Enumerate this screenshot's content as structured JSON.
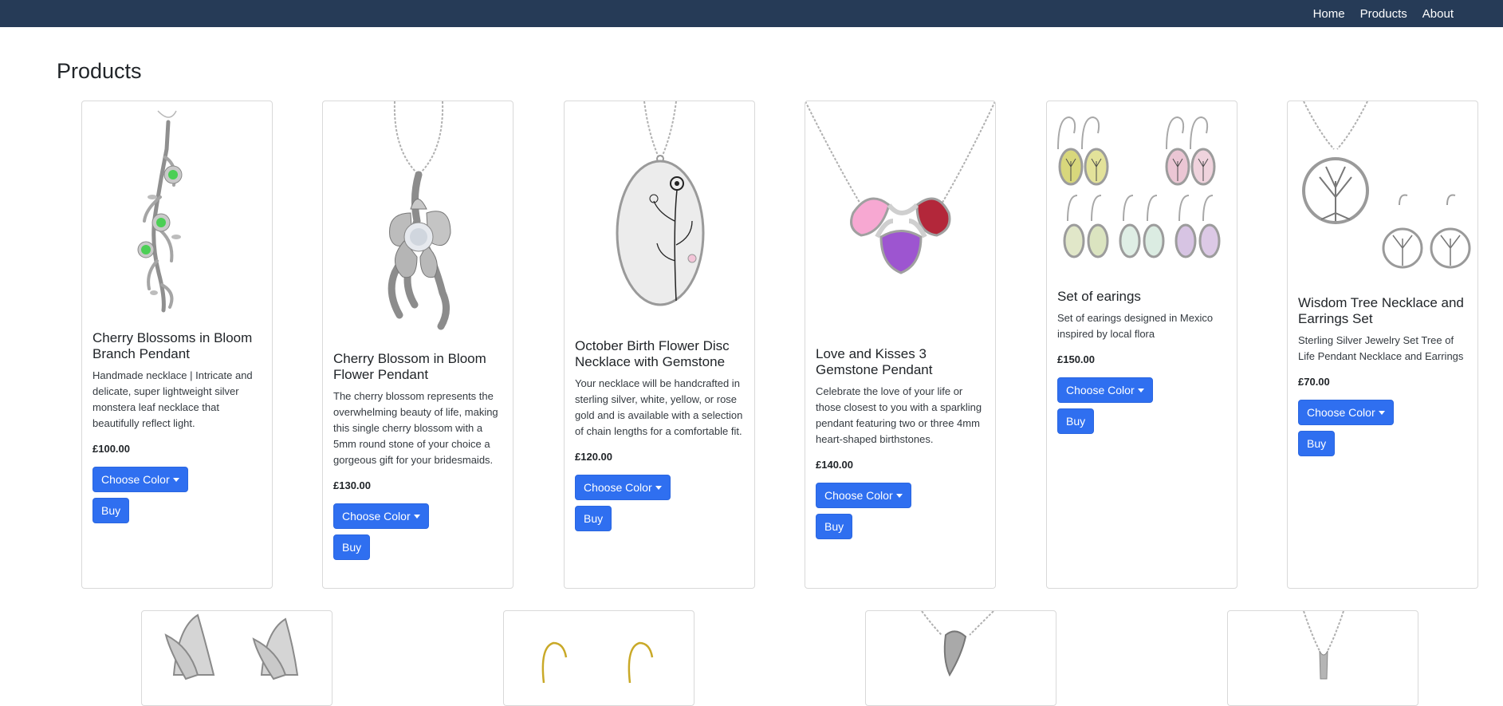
{
  "nav": {
    "links": [
      "Home",
      "Products",
      "About"
    ]
  },
  "page": {
    "title": "Products"
  },
  "products": [
    {
      "title": "Cherry Blossoms in Bloom Branch Pendant",
      "description": "Handmade necklace | Intricate and delicate, super lightweight silver monstera leaf necklace that beautifully reflect light.",
      "price": "£100.00",
      "color_button": "Choose Color",
      "buy_button": "Buy",
      "image": "cherry-blossom-branch-pendant-image"
    },
    {
      "title": "Cherry Blossom in Bloom Flower Pendant",
      "description": "The cherry blossom represents the overwhelming beauty of life, making this single cherry blossom with a 5mm round stone of your choice a gorgeous gift for your bridesmaids.",
      "price": "£130.00",
      "color_button": "Choose Color",
      "buy_button": "Buy",
      "image": "cherry-blossom-flower-pendant-image"
    },
    {
      "title": "October Birth Flower Disc Necklace with Gemstone",
      "description": "Your necklace will be handcrafted in sterling silver, white, yellow, or rose gold and is available with a selection of chain lengths for a comfortable fit.",
      "price": "£120.00",
      "color_button": "Choose Color",
      "buy_button": "Buy",
      "image": "birth-flower-disc-necklace-image"
    },
    {
      "title": "Love and Kisses 3 Gemstone Pendant",
      "description": "Celebrate the love of your life or those closest to you with a sparkling pendant featuring two or three 4mm heart-shaped birthstones.",
      "price": "£140.00",
      "color_button": "Choose Color",
      "buy_button": "Buy",
      "image": "three-heart-gemstone-pendant-image"
    },
    {
      "title": "Set of earings",
      "description": "Set of earings designed in Mexico inspired by local flora",
      "price": "£150.00",
      "color_button": "Choose Color",
      "buy_button": "Buy",
      "image": "tree-earrings-set-image"
    },
    {
      "title": "Wisdom Tree Necklace and Earrings Set",
      "description": "Sterling Silver Jewelry Set Tree of Life Pendant Necklace and Earrings",
      "price": "£70.00",
      "color_button": "Choose Color",
      "buy_button": "Buy",
      "image": "tree-of-life-set-image"
    }
  ],
  "second_row": [
    {
      "image": "leaf-cluster-earrings-image"
    },
    {
      "image": "gold-hook-earrings-image"
    },
    {
      "image": "silver-knot-pendant-image"
    },
    {
      "image": "silver-chain-pendant-image"
    }
  ],
  "colors": {
    "navbar": "#263b57",
    "button": "#2f6ff0",
    "card_border": "#d9d9d9"
  }
}
